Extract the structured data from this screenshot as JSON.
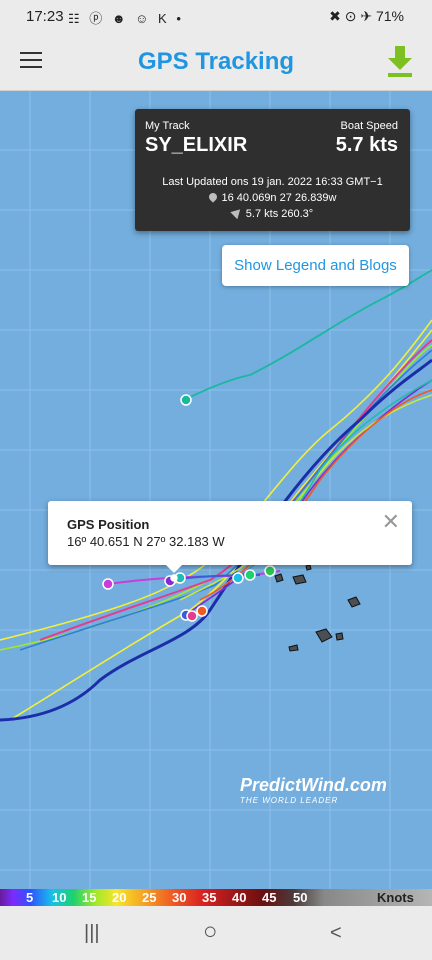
{
  "status": {
    "time": "17:23",
    "apps": "☷ ⓟ ☻ ☺ K •",
    "right": "✖ ⊙ ✈ 71%"
  },
  "app": {
    "title": "GPS Tracking",
    "menu_icon": "hamburger-menu-icon",
    "download_icon": "download-icon",
    "accent": "#2196e0",
    "download_color": "#7cc021"
  },
  "info": {
    "track_label": "My Track",
    "speed_label": "Boat Speed",
    "name": "SY_ELIXIR",
    "speed": "5.7 kts",
    "updated": "Last Updated ons 19 jan. 2022 16:33 GMT−1",
    "position": "16 40.069n 27 26.839w",
    "course": "5.7 kts 260.3°"
  },
  "legend_button": "Show Legend and Blogs",
  "gps_popup": {
    "title": "GPS Position",
    "coords": "16º 40.651 N 27º 32.183 W",
    "close": "✕"
  },
  "brand": {
    "name": "PredictWind.com",
    "tagline": "THE WORLD LEADER"
  },
  "legend": {
    "values": [
      "5",
      "10",
      "15",
      "20",
      "25",
      "30",
      "35",
      "40",
      "45",
      "50"
    ],
    "unit": "Knots"
  },
  "nav": {
    "recents": "|||",
    "home": "○",
    "back": "<"
  }
}
